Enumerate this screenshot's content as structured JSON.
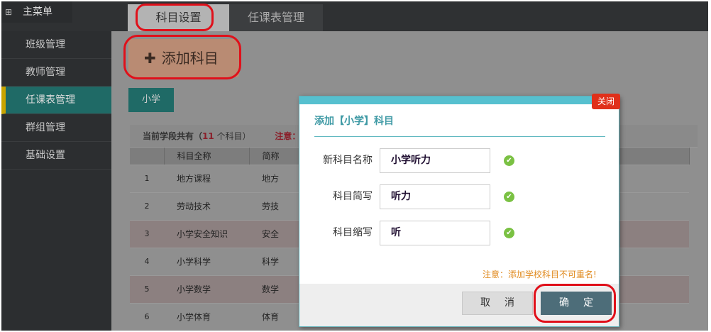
{
  "sidebar": {
    "title": "主菜单",
    "items": [
      {
        "label": "班级管理"
      },
      {
        "label": "教师管理"
      },
      {
        "label": "任课表管理"
      },
      {
        "label": "群组管理"
      },
      {
        "label": "基础设置"
      }
    ]
  },
  "tabs": [
    {
      "label": "科目设置"
    },
    {
      "label": "任课表管理"
    }
  ],
  "add_button": "添加科目",
  "stage_tab": "小学",
  "summary": {
    "prefix": "当前学段共有（",
    "count": "11",
    "suffix": " 个科目）",
    "note": "注意：T"
  },
  "table": {
    "headers": [
      "",
      "科目全称",
      "简称"
    ],
    "rows": [
      [
        "1",
        "地方课程",
        "地方"
      ],
      [
        "2",
        "劳动技术",
        "劳技"
      ],
      [
        "3",
        "小学安全知识",
        "安全"
      ],
      [
        "4",
        "小学科学",
        "科学"
      ],
      [
        "5",
        "小学数学",
        "数学"
      ],
      [
        "6",
        "小学体育",
        "体育"
      ]
    ]
  },
  "dialog": {
    "close": "关闭",
    "title": "添加【小学】科目",
    "fields": [
      {
        "label": "新科目名称",
        "value": "小学听力"
      },
      {
        "label": "科目简写",
        "value": "听力"
      },
      {
        "label": "科目缩写",
        "value": "听"
      }
    ],
    "note": "注意：添加学校科目不可重名!",
    "cancel": "取消",
    "confirm": "确定"
  }
}
